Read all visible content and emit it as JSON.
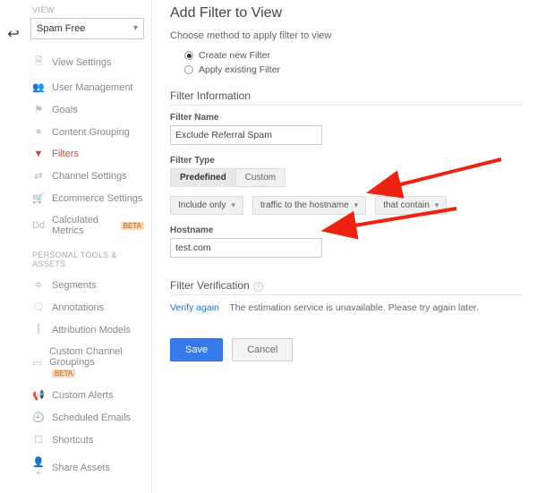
{
  "back_icon": "↩",
  "sidebar": {
    "view_label": "VIEW",
    "view_name": "Spam Free",
    "items": [
      {
        "icon": "🗎",
        "label": "View Settings"
      },
      {
        "icon": "👥",
        "label": "User Management"
      },
      {
        "icon": "⚑",
        "label": "Goals"
      },
      {
        "icon": "⚭",
        "label": "Content Grouping"
      },
      {
        "icon": "▼",
        "label": "Filters",
        "active": true
      },
      {
        "icon": "⇄",
        "label": "Channel Settings"
      },
      {
        "icon": "🛒",
        "label": "Ecommerce Settings"
      },
      {
        "icon": "Dd",
        "label": "Calculated Metrics",
        "beta": "BETA"
      }
    ],
    "section2_label": "PERSONAL TOOLS & ASSETS",
    "items2": [
      {
        "icon": "≑",
        "label": "Segments"
      },
      {
        "icon": "🗨",
        "label": "Annotations"
      },
      {
        "icon": "⫿",
        "label": "Attribution Models"
      },
      {
        "icon": "▭",
        "label": "Custom Channel Groupings",
        "beta": "BETA"
      },
      {
        "icon": "📢",
        "label": "Custom Alerts"
      },
      {
        "icon": "🕘",
        "label": "Scheduled Emails"
      },
      {
        "icon": "☐",
        "label": "Shortcuts"
      },
      {
        "icon": "👤+",
        "label": "Share Assets"
      }
    ]
  },
  "main": {
    "title": "Add Filter to View",
    "choose_label": "Choose method to apply filter to view",
    "radio_create": "Create new Filter",
    "radio_existing": "Apply existing Filter",
    "filter_info": "Filter Information",
    "filter_name_label": "Filter Name",
    "filter_name_value": "Exclude Referral Spam",
    "filter_type_label": "Filter Type",
    "tab_predefined": "Predefined",
    "tab_custom": "Custom",
    "dd1": "Include only",
    "dd2": "traffic to the hostname",
    "dd3": "that contain",
    "hostname_label": "Hostname",
    "hostname_value": "test.com",
    "verification_title": "Filter Verification",
    "verify_link": "Verify again",
    "verify_msg": "The estimation service is unavailable. Please try again later.",
    "save": "Save",
    "cancel": "Cancel"
  }
}
